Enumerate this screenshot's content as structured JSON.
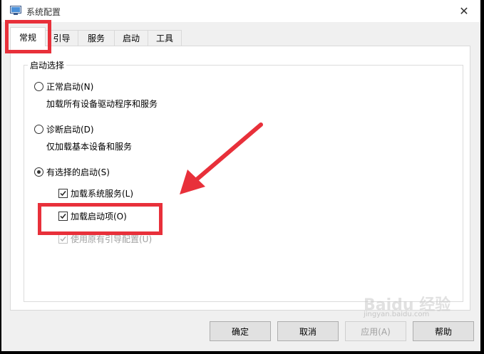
{
  "window": {
    "title": "系统配置",
    "close_icon": "close-icon",
    "app_icon": "msconfig-icon"
  },
  "tabs": [
    {
      "label": "常规",
      "active": true
    },
    {
      "label": "引导",
      "active": false
    },
    {
      "label": "服务",
      "active": false
    },
    {
      "label": "启动",
      "active": false
    },
    {
      "label": "工具",
      "active": false
    }
  ],
  "startup_group": {
    "legend": "启动选择",
    "normal": {
      "label": "正常启动(N)",
      "description": "加载所有设备驱动程序和服务",
      "selected": false
    },
    "diagnostic": {
      "label": "诊断启动(D)",
      "description": "仅加载基本设备和服务",
      "selected": false
    },
    "selective": {
      "label": "有选择的启动(S)",
      "selected": true
    },
    "options": {
      "load_system_services": {
        "label": "加载系统服务(L)",
        "checked": true,
        "enabled": true
      },
      "load_startup_items": {
        "label": "加载启动项(O)",
        "checked": true,
        "enabled": true
      },
      "use_original_boot": {
        "label": "使用原有引导配置(U)",
        "checked": true,
        "enabled": false
      }
    }
  },
  "buttons": {
    "ok": "确定",
    "cancel": "取消",
    "apply": "应用(A)",
    "help": "帮助"
  },
  "annotation": {
    "highlight_color": "#e8303a",
    "arrow_color": "#e8303a"
  },
  "watermark": {
    "main": "Baidu 经验",
    "sub": "jingyan.baidu.com"
  }
}
